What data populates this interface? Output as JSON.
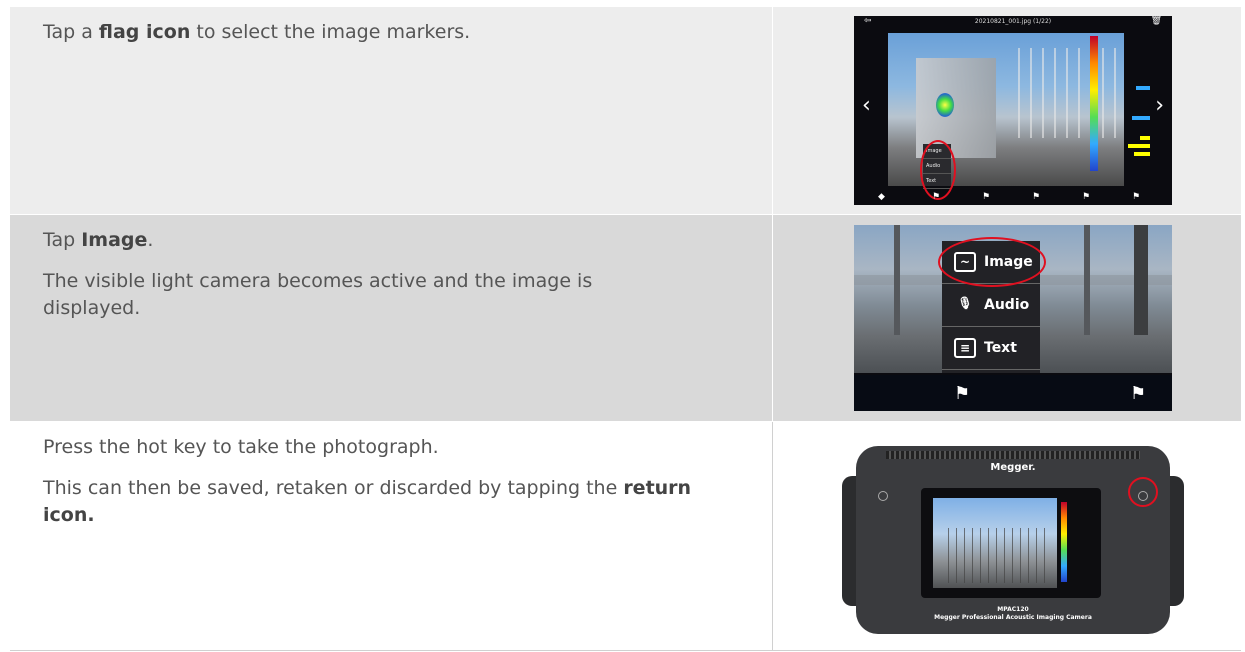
{
  "rows": [
    {
      "segments": [
        {
          "text": "Tap a ",
          "bold": false
        },
        {
          "text": "flag icon",
          "bold": true
        },
        {
          "text": " to select the image markers.",
          "bold": false
        }
      ]
    },
    {
      "p1": {
        "pre": "Tap ",
        "bold": "Image",
        "post": "."
      },
      "p2": "The visible light camera becomes active and the image is displayed."
    },
    {
      "p1": "Press the hot key to take the photograph.",
      "p2": {
        "pre": "This can then be saved, retaken or discarded by tapping the ",
        "bold": "return icon."
      }
    }
  ],
  "screenshot1": {
    "title": "20210821_001.jpg (1/22)",
    "menu": [
      "Image",
      "Audio",
      "Text"
    ]
  },
  "screenshot2": {
    "menu": [
      {
        "label": "Image",
        "icon": "image-icon"
      },
      {
        "label": "Audio",
        "icon": "microphone-icon"
      },
      {
        "label": "Text",
        "icon": "note-icon"
      }
    ]
  },
  "device": {
    "brand": "Megger.",
    "model": "MPAC120",
    "subtitle": "Megger Professional Acoustic Imaging Camera"
  },
  "colors": {
    "row1": "#ededed",
    "row2": "#d9d9d9",
    "highlight": "#e01020"
  }
}
